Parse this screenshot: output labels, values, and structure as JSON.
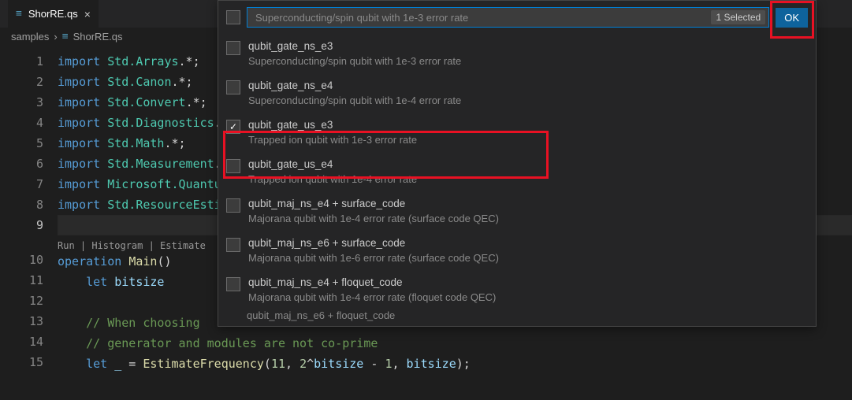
{
  "tab": {
    "filename": "ShorRE.qs"
  },
  "breadcrumb": {
    "folder": "samples",
    "file": "ShorRE.qs"
  },
  "gutter": [
    "1",
    "2",
    "3",
    "4",
    "5",
    "6",
    "7",
    "8",
    "9",
    "10",
    "11",
    "12",
    "13",
    "14",
    "15"
  ],
  "code": {
    "imports": [
      {
        "ns": "Std.Arrays",
        "tail": ".*"
      },
      {
        "ns": "Std.Canon",
        "tail": ".*"
      },
      {
        "ns": "Std.Convert",
        "tail": ".*"
      },
      {
        "ns": "Std.Diagnostics",
        "tail": ".*"
      },
      {
        "ns": "Std.Math",
        "tail": ".*"
      },
      {
        "ns": "Std.Measurement",
        "tail": ".*"
      },
      {
        "ns": "Microsoft.Quantum",
        "tail": ".*"
      },
      {
        "ns": "Std.ResourceEstimation",
        "tail": ".*"
      }
    ],
    "codelens": "Run | Histogram | Estimate",
    "op_kw": "operation",
    "op_name": "Main",
    "let_kw": "let",
    "bitsize_id": "bitsize",
    "cm1": "// When choosing",
    "cm2": "// generator and modules are not co-prime",
    "underscore": "_",
    "eq": " = ",
    "estfn": "EstimateFrequency",
    "call_open": "(",
    "n11": "11",
    "sep1": ", ",
    "n2": "2",
    "caret": "^",
    "bits1": "bitsize",
    "minus": " - ",
    "n1": "1",
    "sep2": ", ",
    "bits2": "bitsize",
    "call_close": ");"
  },
  "quickpick": {
    "placeholder": "Superconducting/spin qubit with 1e-3 error rate",
    "badge": "1 Selected",
    "ok": "OK",
    "items": [
      {
        "label": "qubit_gate_ns_e3",
        "desc": "Superconducting/spin qubit with 1e-3 error rate",
        "checked": false
      },
      {
        "label": "qubit_gate_ns_e4",
        "desc": "Superconducting/spin qubit with 1e-4 error rate",
        "checked": false
      },
      {
        "label": "qubit_gate_us_e3",
        "desc": "Trapped ion qubit with 1e-3 error rate",
        "checked": true
      },
      {
        "label": "qubit_gate_us_e4",
        "desc": "Trapped ion qubit with 1e-4 error rate",
        "checked": false
      },
      {
        "label": "qubit_maj_ns_e4 + surface_code",
        "desc": "Majorana qubit with 1e-4 error rate (surface code QEC)",
        "checked": false
      },
      {
        "label": "qubit_maj_ns_e6 + surface_code",
        "desc": "Majorana qubit with 1e-6 error rate (surface code QEC)",
        "checked": false
      },
      {
        "label": "qubit_maj_ns_e4 + floquet_code",
        "desc": "Majorana qubit with 1e-4 error rate (floquet code QEC)",
        "checked": false
      }
    ],
    "cutoff": "qubit_maj_ns_e6 + floquet_code"
  }
}
